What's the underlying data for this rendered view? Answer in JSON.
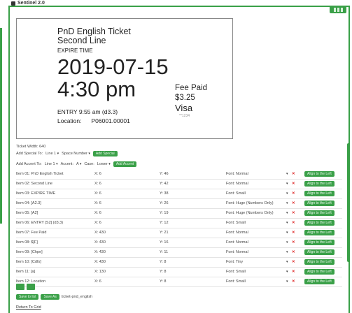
{
  "app": {
    "title": "Sentinel 2.0"
  },
  "ticket": {
    "line1": "PnD English Ticket",
    "line2": "Second Line",
    "line3": "EXPIRE TIME",
    "date": "2019-07-15",
    "time": "4:30 pm",
    "fee_label": "Fee Paid",
    "fee_value": "$3.25",
    "card": "Visa",
    "card_last4": "**1234",
    "entry": "ENTRY 9:55 am  (d3.3)",
    "location_label": "Location:",
    "location_value": "P06001.00001"
  },
  "controls": {
    "ticket_width": "Ticket Width:  640",
    "add_special_label": "Add Special To:",
    "add_special_line": "Line 1",
    "add_special_type": "Space Number",
    "add_special_button": "Add Special",
    "add_accent_label": "Add Accent To:",
    "add_accent_line": "Line 1",
    "accent_label": "Accent:",
    "accent_value": "A",
    "case_label": "Case:",
    "case_value": "Lower",
    "add_accent_button": "Add Accent"
  },
  "items": [
    {
      "label": "Item 01:  PnD English Ticket",
      "x": "X:  6",
      "y": "Y:  46",
      "font": "Font:  Normal",
      "align": "Align to the Left"
    },
    {
      "label": "Item 02:  Second Line",
      "x": "X:  6",
      "y": "Y:  42",
      "font": "Font:  Normal",
      "align": "Align to the Left"
    },
    {
      "label": "Item 03:  EXPIRE TIME",
      "x": "X:  6",
      "y": "Y:  38",
      "font": "Font:  Small",
      "align": "Align to the Left"
    },
    {
      "label": "Item 04:  [A2.3]",
      "x": "X:  6",
      "y": "Y:  26",
      "font": "Font:  Huge (Numbers Only)",
      "align": "Align to the Left"
    },
    {
      "label": "Item 05:  [A2]",
      "x": "X:  6",
      "y": "Y:  19",
      "font": "Font:  Huge (Numbers Only)",
      "align": "Align to the Left"
    },
    {
      "label": "Item 06:  ENTRY  [S2]  (d3.3)",
      "x": "X:  6",
      "y": "Y:  12",
      "font": "Font:  Small",
      "align": "Align to the Left"
    },
    {
      "label": "Item 07:  Fee Paid",
      "x": "X:  430",
      "y": "Y:  21",
      "font": "Font:  Normal",
      "align": "Align to the Left"
    },
    {
      "label": "Item 08:  $[F]",
      "x": "X:  430",
      "y": "Y:  16",
      "font": "Font:  Normal",
      "align": "Align to the Left"
    },
    {
      "label": "Item 09:  [Chpe]",
      "x": "X:  430",
      "y": "Y:  11",
      "font": "Font:  Normal",
      "align": "Align to the Left"
    },
    {
      "label": "Item 10:  [Cdfs]",
      "x": "X:  430",
      "y": "Y:  8",
      "font": "Font:  Tiny",
      "align": "Align to the Left"
    },
    {
      "label": "Item 11:  [a]",
      "x": "X:  130",
      "y": "Y:  8",
      "font": "Font:  Small",
      "align": "Align to the Left"
    },
    {
      "label": "Item 12:  Location",
      "x": "X:  6",
      "y": "Y:  8",
      "font": "Font:  Small",
      "align": "Align to the Left"
    }
  ],
  "footer": {
    "save_button": "Save to list",
    "save_as_button": "Save As",
    "ticket_name": "ticket-pnd_english",
    "return_link": "Return To Grid"
  },
  "colors": {
    "accent": "#3aa048",
    "delete": "#dd2222"
  }
}
